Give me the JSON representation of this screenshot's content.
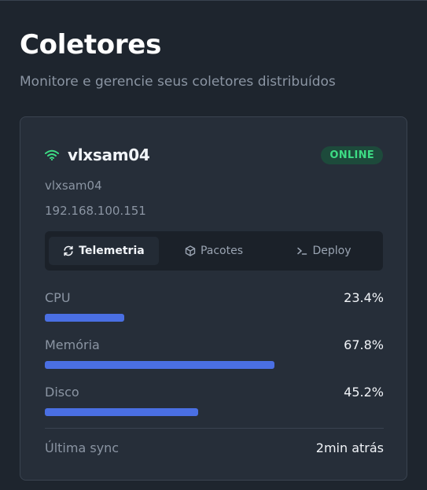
{
  "header": {
    "title": "Coletores",
    "subtitle": "Monitore e gerencie seus coletores distribuídos"
  },
  "collector": {
    "name": "vlxsam04",
    "status": "ONLINE",
    "status_color": "#3ddc84",
    "hostname": "vlxsam04",
    "ip": "192.168.100.151",
    "icon": "wifi-icon",
    "tabs": [
      {
        "label": "Telemetria",
        "icon": "refresh-icon",
        "active": true
      },
      {
        "label": "Pacotes",
        "icon": "package-icon",
        "active": false
      },
      {
        "label": "Deploy",
        "icon": "terminal-icon",
        "active": false
      }
    ],
    "metrics": [
      {
        "label": "CPU",
        "value": "23.4%",
        "percent": 23.4
      },
      {
        "label": "Memória",
        "value": "67.8%",
        "percent": 67.8
      },
      {
        "label": "Disco",
        "value": "45.2%",
        "percent": 45.2
      }
    ],
    "bar_color": "#4a6fe3",
    "last_sync_label": "Última sync",
    "last_sync_value": "2min atrás"
  }
}
